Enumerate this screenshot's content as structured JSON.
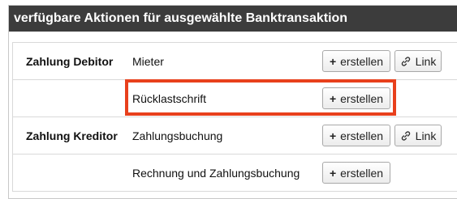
{
  "panel": {
    "title": "verfügbare Aktionen für ausgewählte Banktransaktion"
  },
  "groups": [
    {
      "label": "Zahlung Debitor",
      "actions": [
        {
          "label": "Mieter",
          "create": "erstellen",
          "link": "Link"
        },
        {
          "label": "Rücklastschrift",
          "create": "erstellen",
          "highlighted": true
        }
      ]
    },
    {
      "label": "Zahlung Kreditor",
      "actions": [
        {
          "label": "Zahlungsbuchung",
          "create": "erstellen",
          "link": "Link"
        },
        {
          "label": "Rechnung und Zahlungsbuchung",
          "create": "erstellen"
        }
      ]
    }
  ],
  "icons": {
    "create": "plus-icon",
    "link": "link-icon"
  },
  "colors": {
    "header_bg": "#3c3c3c",
    "highlight": "#e8401c"
  }
}
